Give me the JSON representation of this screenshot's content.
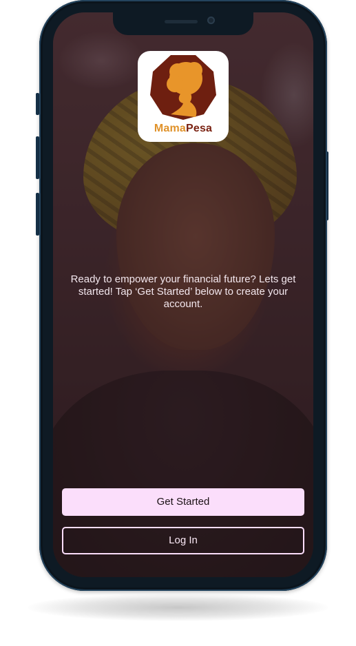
{
  "app": {
    "logo_part1": "Mama",
    "logo_part2": "Pesa"
  },
  "welcome": {
    "tagline": "Ready to empower your financial future? Lets get started! Tap ‘Get Started’ below to create your account."
  },
  "actions": {
    "primary_label": "Get Started",
    "secondary_label": "Log In"
  },
  "colors": {
    "primary_button_bg": "#fbdefb",
    "logo_orange": "#e0922a",
    "logo_maroon": "#7a2212"
  }
}
